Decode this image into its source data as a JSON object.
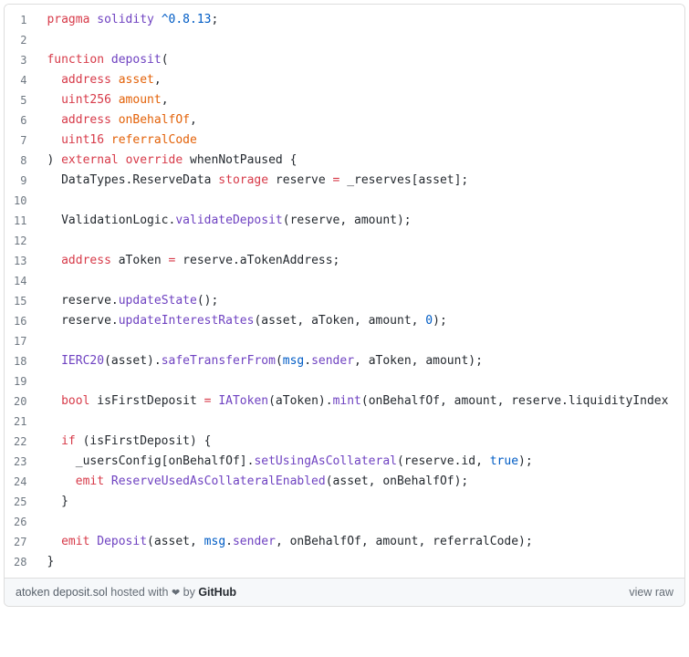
{
  "lines": [
    [
      {
        "t": "pragma",
        "c": "kw"
      },
      {
        "t": " "
      },
      {
        "t": "solidity",
        "c": "fn"
      },
      {
        "t": " "
      },
      {
        "t": "^0.8.13",
        "c": "blue"
      },
      {
        "t": ";"
      }
    ],
    [],
    [
      {
        "t": "function",
        "c": "kw"
      },
      {
        "t": " "
      },
      {
        "t": "deposit",
        "c": "fn"
      },
      {
        "t": "("
      }
    ],
    [
      {
        "t": "  "
      },
      {
        "t": "address",
        "c": "kw"
      },
      {
        "t": " "
      },
      {
        "t": "asset",
        "c": "id"
      },
      {
        "t": ","
      }
    ],
    [
      {
        "t": "  "
      },
      {
        "t": "uint256",
        "c": "kw"
      },
      {
        "t": " "
      },
      {
        "t": "amount",
        "c": "id"
      },
      {
        "t": ","
      }
    ],
    [
      {
        "t": "  "
      },
      {
        "t": "address",
        "c": "kw"
      },
      {
        "t": " "
      },
      {
        "t": "onBehalfOf",
        "c": "id"
      },
      {
        "t": ","
      }
    ],
    [
      {
        "t": "  "
      },
      {
        "t": "uint16",
        "c": "kw"
      },
      {
        "t": " "
      },
      {
        "t": "referralCode",
        "c": "id"
      }
    ],
    [
      {
        "t": ") "
      },
      {
        "t": "external",
        "c": "kw"
      },
      {
        "t": " "
      },
      {
        "t": "override",
        "c": "kw"
      },
      {
        "t": " whenNotPaused {"
      }
    ],
    [
      {
        "t": "  DataTypes.ReserveData "
      },
      {
        "t": "storage",
        "c": "kw"
      },
      {
        "t": " reserve "
      },
      {
        "t": "=",
        "c": "kw"
      },
      {
        "t": " _reserves[asset];"
      }
    ],
    [],
    [
      {
        "t": "  ValidationLogic."
      },
      {
        "t": "validateDeposit",
        "c": "fn"
      },
      {
        "t": "(reserve, amount);"
      }
    ],
    [],
    [
      {
        "t": "  "
      },
      {
        "t": "address",
        "c": "kw"
      },
      {
        "t": " aToken "
      },
      {
        "t": "=",
        "c": "kw"
      },
      {
        "t": " reserve.aTokenAddress;"
      }
    ],
    [],
    [
      {
        "t": "  reserve."
      },
      {
        "t": "updateState",
        "c": "fn"
      },
      {
        "t": "();"
      }
    ],
    [
      {
        "t": "  reserve."
      },
      {
        "t": "updateInterestRates",
        "c": "fn"
      },
      {
        "t": "(asset, aToken, amount, "
      },
      {
        "t": "0",
        "c": "blue"
      },
      {
        "t": ");"
      }
    ],
    [],
    [
      {
        "t": "  "
      },
      {
        "t": "IERC20",
        "c": "fn"
      },
      {
        "t": "(asset)."
      },
      {
        "t": "safeTransferFrom",
        "c": "fn"
      },
      {
        "t": "("
      },
      {
        "t": "msg",
        "c": "blue"
      },
      {
        "t": "."
      },
      {
        "t": "sender",
        "c": "fn"
      },
      {
        "t": ", aToken, amount);"
      }
    ],
    [],
    [
      {
        "t": "  "
      },
      {
        "t": "bool",
        "c": "kw"
      },
      {
        "t": " isFirstDeposit "
      },
      {
        "t": "=",
        "c": "kw"
      },
      {
        "t": " "
      },
      {
        "t": "IAToken",
        "c": "fn"
      },
      {
        "t": "(aToken)."
      },
      {
        "t": "mint",
        "c": "fn"
      },
      {
        "t": "(onBehalfOf, amount, reserve.liquidityIndex"
      }
    ],
    [],
    [
      {
        "t": "  "
      },
      {
        "t": "if",
        "c": "kw"
      },
      {
        "t": " (isFirstDeposit) {"
      }
    ],
    [
      {
        "t": "    _usersConfig[onBehalfOf]."
      },
      {
        "t": "setUsingAsCollateral",
        "c": "fn"
      },
      {
        "t": "(reserve.id, "
      },
      {
        "t": "true",
        "c": "blue"
      },
      {
        "t": ");"
      }
    ],
    [
      {
        "t": "    "
      },
      {
        "t": "emit",
        "c": "kw"
      },
      {
        "t": " "
      },
      {
        "t": "ReserveUsedAsCollateralEnabled",
        "c": "fn"
      },
      {
        "t": "(asset, onBehalfOf);"
      }
    ],
    [
      {
        "t": "  }"
      }
    ],
    [],
    [
      {
        "t": "  "
      },
      {
        "t": "emit",
        "c": "kw"
      },
      {
        "t": " "
      },
      {
        "t": "Deposit",
        "c": "fn"
      },
      {
        "t": "(asset, "
      },
      {
        "t": "msg",
        "c": "blue"
      },
      {
        "t": "."
      },
      {
        "t": "sender",
        "c": "fn"
      },
      {
        "t": ", onBehalfOf, amount, referralCode);"
      }
    ],
    [
      {
        "t": "}"
      }
    ]
  ],
  "meta": {
    "filename": "atoken deposit.sol",
    "hosted_prefix": " hosted with ",
    "heart": "❤",
    "by": " by ",
    "host": "GitHub",
    "view_raw": "view raw"
  }
}
